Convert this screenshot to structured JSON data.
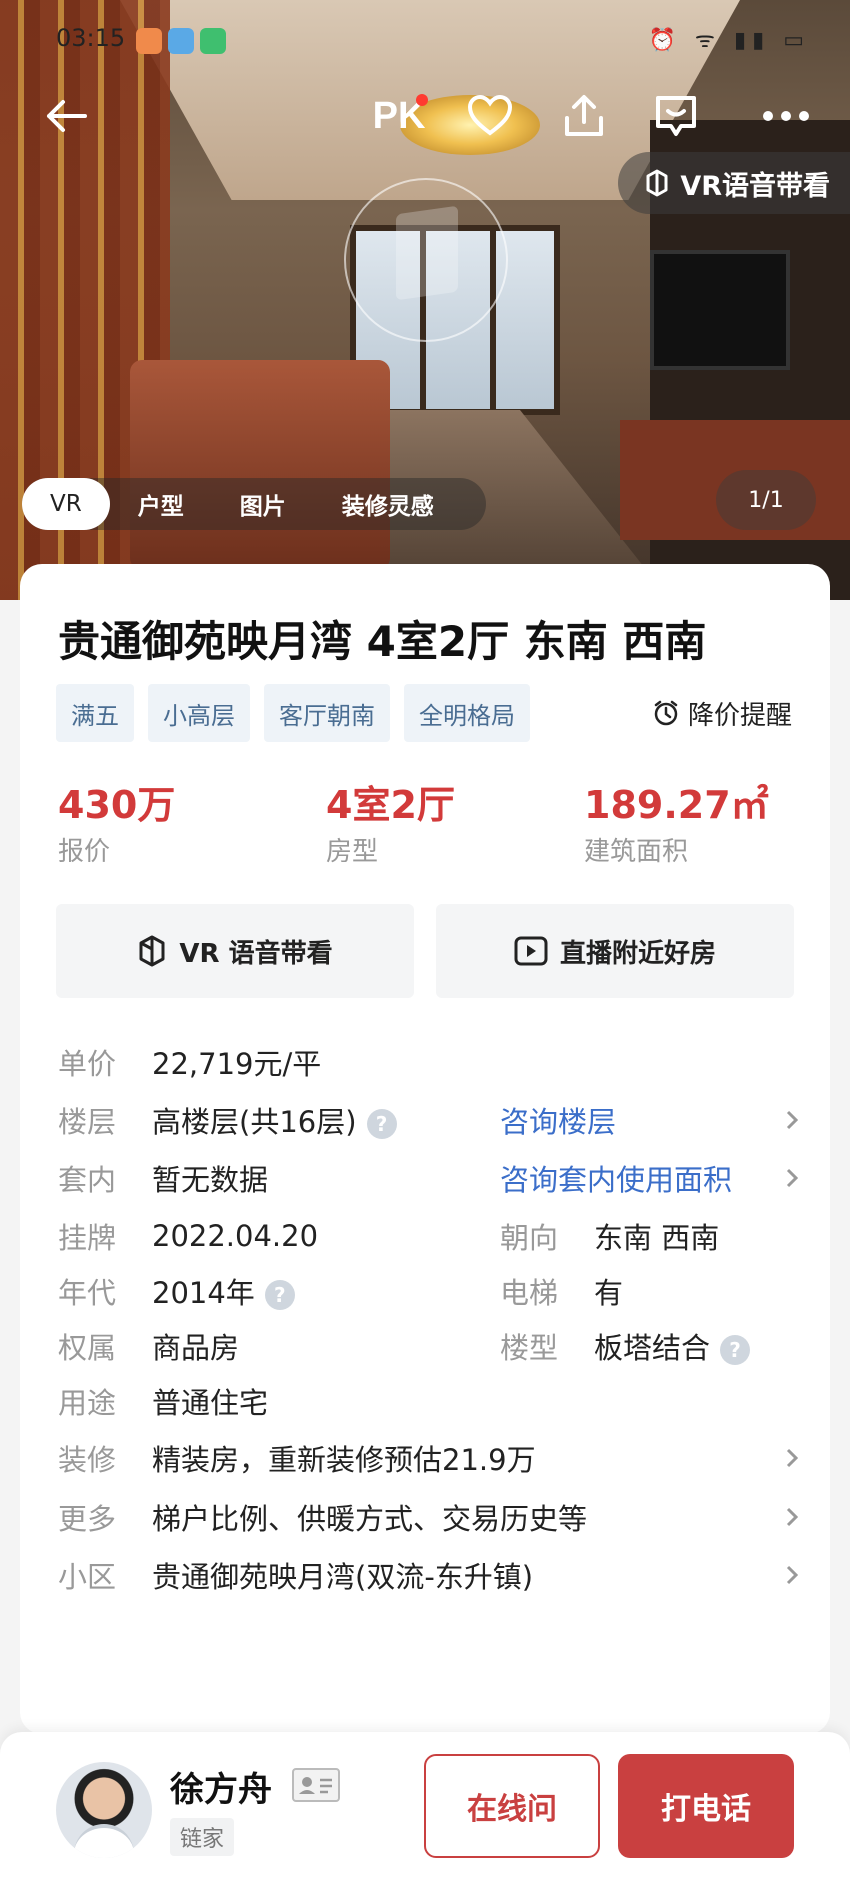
{
  "status_bar": {
    "time": "03:15",
    "app_icon_colors": [
      "#f08a4b",
      "#5aa9e6",
      "#3fbf6f"
    ],
    "icons": "⏰ ᯤ ▮▮ ▭"
  },
  "nav": {
    "back_icon": "back-arrow-icon",
    "pk_label": "PK",
    "pk_has_dot": true
  },
  "vr_guide_pill": {
    "label": "VR语音带看"
  },
  "media_tabs": [
    {
      "label": "VR",
      "active": true
    },
    {
      "label": "户型",
      "active": false
    },
    {
      "label": "图片",
      "active": false
    },
    {
      "label": "装修灵感",
      "active": false
    }
  ],
  "media_counter": "1/1",
  "listing": {
    "title": "贵通御苑映月湾 4室2厅 东南 西南",
    "tags": [
      "满五",
      "小高层",
      "客厅朝南",
      "全明格局"
    ],
    "price_alert": "降价提醒",
    "stats": [
      {
        "value": "430万",
        "label": "报价"
      },
      {
        "value": "4室2厅",
        "label": "房型"
      },
      {
        "value": "189.27㎡",
        "label": "建筑面积"
      }
    ]
  },
  "actions": {
    "vr_tour": "VR 语音带看",
    "live": "直播附近好房"
  },
  "info": {
    "unit_price": {
      "k": "单价",
      "v": "22,719元/平"
    },
    "floor": {
      "k": "楼层",
      "v": "高楼层(共16层)",
      "link": "咨询楼层"
    },
    "inner": {
      "k": "套内",
      "v": "暂无数据",
      "link": "咨询套内使用面积"
    },
    "listed": {
      "k": "挂牌",
      "v": "2022.04.20",
      "k2": "朝向",
      "v2": "东南 西南"
    },
    "year": {
      "k": "年代",
      "v": "2014年",
      "k2": "电梯",
      "v2": "有"
    },
    "ownership": {
      "k": "权属",
      "v": "商品房",
      "k2": "楼型",
      "v2": "板塔结合"
    },
    "usage": {
      "k": "用途",
      "v": "普通住宅"
    },
    "decoration": {
      "k": "装修",
      "v": "精装房，重新装修预估21.9万"
    },
    "more": {
      "k": "更多",
      "v": "梯户比例、供暖方式、交易历史等"
    },
    "community": {
      "k": "小区",
      "v": "贵通御苑映月湾(双流-东升镇)"
    }
  },
  "agent": {
    "name": "徐方舟",
    "company": "链家",
    "online_button": "在线问",
    "call_button": "打电话"
  },
  "colors": {
    "accent_red": "#d23a3a",
    "link_blue": "#3b6ec9",
    "tag_bg": "#eef3f8",
    "tag_text": "#4a6d92"
  }
}
